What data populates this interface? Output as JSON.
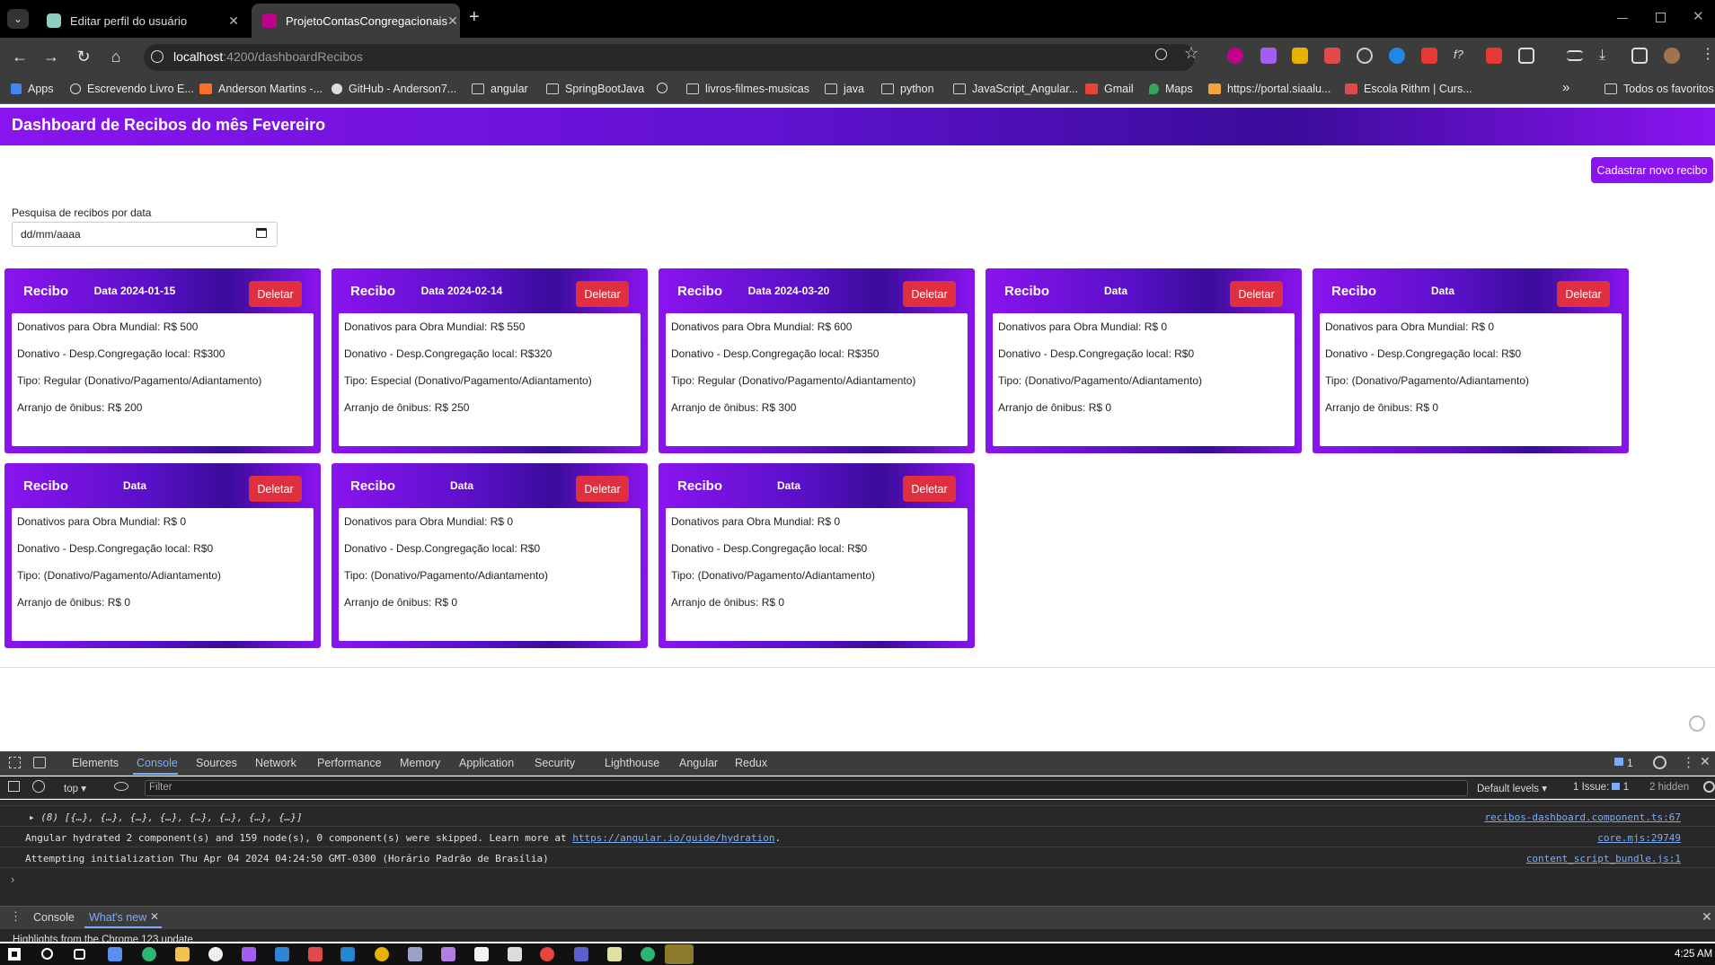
{
  "browser": {
    "tabs": [
      {
        "title": "Editar perfil do usuário",
        "active": false
      },
      {
        "title": "ProjetoContasCongregacionais",
        "active": true
      }
    ],
    "new_tab": "+",
    "url_host": "localhost",
    "url_path": ":4200/dashboardRecibos",
    "bookmarks": [
      {
        "label": "Apps"
      },
      {
        "label": "Escrevendo Livro E..."
      },
      {
        "label": "Anderson Martins -..."
      },
      {
        "label": "GitHub - Anderson7..."
      },
      {
        "label": "angular"
      },
      {
        "label": "SpringBootJava"
      },
      {
        "label": ""
      },
      {
        "label": "livros-filmes-musicas"
      },
      {
        "label": "java"
      },
      {
        "label": "python"
      },
      {
        "label": "JavaScript_Angular..."
      },
      {
        "label": "Gmail"
      },
      {
        "label": "Maps"
      },
      {
        "label": "https://portal.siaalu..."
      },
      {
        "label": "Escola Rithm | Curs..."
      },
      {
        "label": "»"
      },
      {
        "label": "Todos os favoritos"
      }
    ]
  },
  "app": {
    "title": "Dashboard de Recibos do mês Fevereiro",
    "new_button": "Cadastrar novo recibo",
    "search_label": "Pesquisa de recibos por data",
    "date_placeholder": "dd/mm/aaaa",
    "cards": [
      {
        "label": "Recibo",
        "date": "Data 2024-01-15",
        "delete": "Deletar",
        "lines": [
          "Donativos para Obra Mundial: R$ 500",
          "Donativo - Desp.Congregação local: R$300",
          "Tipo: Regular (Donativo/Pagamento/Adiantamento)",
          "Arranjo de ônibus: R$ 200"
        ]
      },
      {
        "label": "Recibo",
        "date": "Data 2024-02-14",
        "delete": "Deletar",
        "lines": [
          "Donativos para Obra Mundial: R$ 550",
          "Donativo - Desp.Congregação local: R$320",
          "Tipo: Especial (Donativo/Pagamento/Adiantamento)",
          "Arranjo de ônibus: R$ 250"
        ]
      },
      {
        "label": "Recibo",
        "date": "Data 2024-03-20",
        "delete": "Deletar",
        "lines": [
          "Donativos para Obra Mundial: R$ 600",
          "Donativo - Desp.Congregação local: R$350",
          "Tipo: Regular (Donativo/Pagamento/Adiantamento)",
          "Arranjo de ônibus: R$ 300"
        ]
      },
      {
        "label": "Recibo",
        "date": "Data",
        "delete": "Deletar",
        "lines": [
          "Donativos para Obra Mundial: R$ 0",
          "Donativo - Desp.Congregação local: R$0",
          "Tipo: (Donativo/Pagamento/Adiantamento)",
          "Arranjo de ônibus: R$ 0"
        ]
      },
      {
        "label": "Recibo",
        "date": "Data",
        "delete": "Deletar",
        "lines": [
          "Donativos para Obra Mundial: R$ 0",
          "Donativo - Desp.Congregação local: R$0",
          "Tipo: (Donativo/Pagamento/Adiantamento)",
          "Arranjo de ônibus: R$ 0"
        ]
      },
      {
        "label": "Recibo",
        "date": "Data",
        "delete": "Deletar",
        "lines": [
          "Donativos para Obra Mundial: R$ 0",
          "Donativo - Desp.Congregação local: R$0",
          "Tipo: (Donativo/Pagamento/Adiantamento)",
          "Arranjo de ônibus: R$ 0"
        ]
      },
      {
        "label": "Recibo",
        "date": "Data",
        "delete": "Deletar",
        "lines": [
          "Donativos para Obra Mundial: R$ 0",
          "Donativo - Desp.Congregação local: R$0",
          "Tipo: (Donativo/Pagamento/Adiantamento)",
          "Arranjo de ônibus: R$ 0"
        ]
      },
      {
        "label": "Recibo",
        "date": "Data",
        "delete": "Deletar",
        "lines": [
          "Donativos para Obra Mundial: R$ 0",
          "Donativo - Desp.Congregação local: R$0",
          "Tipo: (Donativo/Pagamento/Adiantamento)",
          "Arranjo de ônibus: R$ 0"
        ]
      }
    ]
  },
  "devtools": {
    "tabs": [
      "Elements",
      "Console",
      "Sources",
      "Network",
      "Performance",
      "Memory",
      "Application",
      "Security",
      "Lighthouse",
      "Angular",
      "Redux"
    ],
    "active_tab": "Console",
    "issues_badge": "1",
    "context": "top",
    "filter_placeholder": "Filter",
    "levels": "Default levels",
    "issue_count": "1 Issue:",
    "issue_num": "1",
    "hidden": "2 hidden",
    "console_lines": [
      {
        "text": "▸ (8) [{…}, {…}, {…}, {…}, {…}, {…}, {…}, {…}]",
        "source": "recibos-dashboard.component.ts:67"
      },
      {
        "text_before": "Angular hydrated 2 component(s) and 159 node(s), 0 component(s) were skipped. Learn more at ",
        "link": "https://angular.io/guide/hydration",
        "text_after": ".",
        "source": "core.mjs:29749"
      },
      {
        "text": "Attempting initialization Thu Apr 04 2024 04:24:50 GMT-0300 (Horário Padrão de Brasília)",
        "source": "content_script_bundle.js:1"
      }
    ],
    "prompt": "›",
    "drawer_tabs": [
      "Console",
      "What's new"
    ],
    "drawer_text": "Highlights from the Chrome 123 update"
  },
  "taskbar": {
    "clock": "4:25 AM"
  },
  "colors": {
    "purple": "#8a14ef",
    "purple_dark": "#3a0c9a",
    "delete_red": "#e0303f",
    "devtools_blue": "#7cacf8"
  }
}
